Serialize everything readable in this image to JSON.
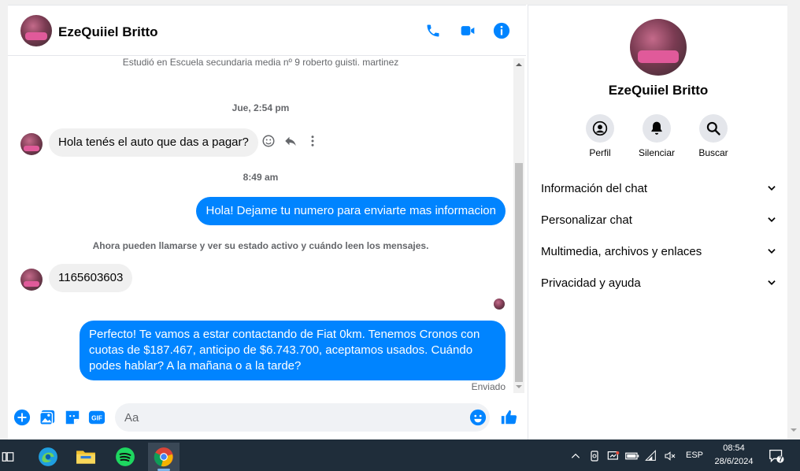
{
  "chat": {
    "contact_name": "EzeQuiiel Britto",
    "profile_info": "Estudió en Escuela secundaria media nº 9 roberto guisti. martinez",
    "timestamps": [
      "Jue, 2:54 pm",
      "8:49 am"
    ],
    "notice": "Ahora pueden llamarse y ver su estado activo y cuándo leen los mensajes.",
    "messages": [
      {
        "direction": "incoming",
        "text": "Hola tenés el auto que das a pagar?"
      },
      {
        "direction": "outgoing",
        "text": "Hola! Dejame tu numero para enviarte mas informacion"
      },
      {
        "direction": "incoming",
        "text": "1165603603"
      },
      {
        "direction": "outgoing",
        "text": "Perfecto! Te vamos a estar contactando de Fiat 0km. Tenemos Cronos con cuotas de $187.467, anticipo de $6.743.700, aceptamos usados. Cuándo podes hablar? A la mañana o a la tarde?"
      }
    ],
    "sent_status": "Enviado",
    "composer_placeholder": "Aa",
    "header_icons": [
      "phone-icon",
      "video-icon",
      "info-icon"
    ],
    "composer_icons": [
      "plus-icon",
      "image-icon",
      "sticker-icon",
      "gif-icon",
      "emoji-icon",
      "like-icon"
    ],
    "accent_color": "#0084ff"
  },
  "info_panel": {
    "name": "EzeQuiiel Britto",
    "actions": [
      {
        "label": "Perfil",
        "icon": "profile-icon"
      },
      {
        "label": "Silenciar",
        "icon": "bell-icon"
      },
      {
        "label": "Buscar",
        "icon": "search-icon"
      }
    ],
    "sections": [
      "Información del chat",
      "Personalizar chat",
      "Multimedia, archivos y enlaces",
      "Privacidad y ayuda"
    ]
  },
  "taskbar": {
    "apps": [
      "task-view-icon",
      "edge-icon",
      "file-explorer-icon",
      "spotify-icon",
      "chrome-icon"
    ],
    "language": "ESP",
    "time": "08:54",
    "date": "28/6/2024",
    "notification_count": "7"
  }
}
